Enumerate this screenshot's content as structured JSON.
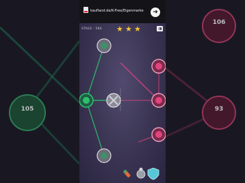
{
  "ad": {
    "text": "kaufland.de/K-Free/Eigenmarke",
    "action_icon": "arrow-right-icon"
  },
  "hud": {
    "stage_label": "STAGE : 584",
    "stars": [
      "★",
      "★",
      "★"
    ],
    "pause_icon": "pause-icon"
  },
  "nodes": {
    "green_main": {
      "value": "",
      "color": "#2fbf6e"
    },
    "pink_top": {
      "value": "",
      "color": "#e0437e"
    },
    "pink_mid": {
      "value": "",
      "color": "#e0437e"
    },
    "pink_bottom": {
      "value": "",
      "color": "#e0437e"
    }
  },
  "background_nodes": {
    "left_value": "105",
    "right_top_value": "106",
    "right_bottom_value": "93"
  },
  "powerups": [
    "rocket-icon",
    "bomb-icon",
    "shield-icon"
  ],
  "colors": {
    "player": "#2fbf6e",
    "enemy": "#e0437e",
    "star": "#f3c436"
  }
}
